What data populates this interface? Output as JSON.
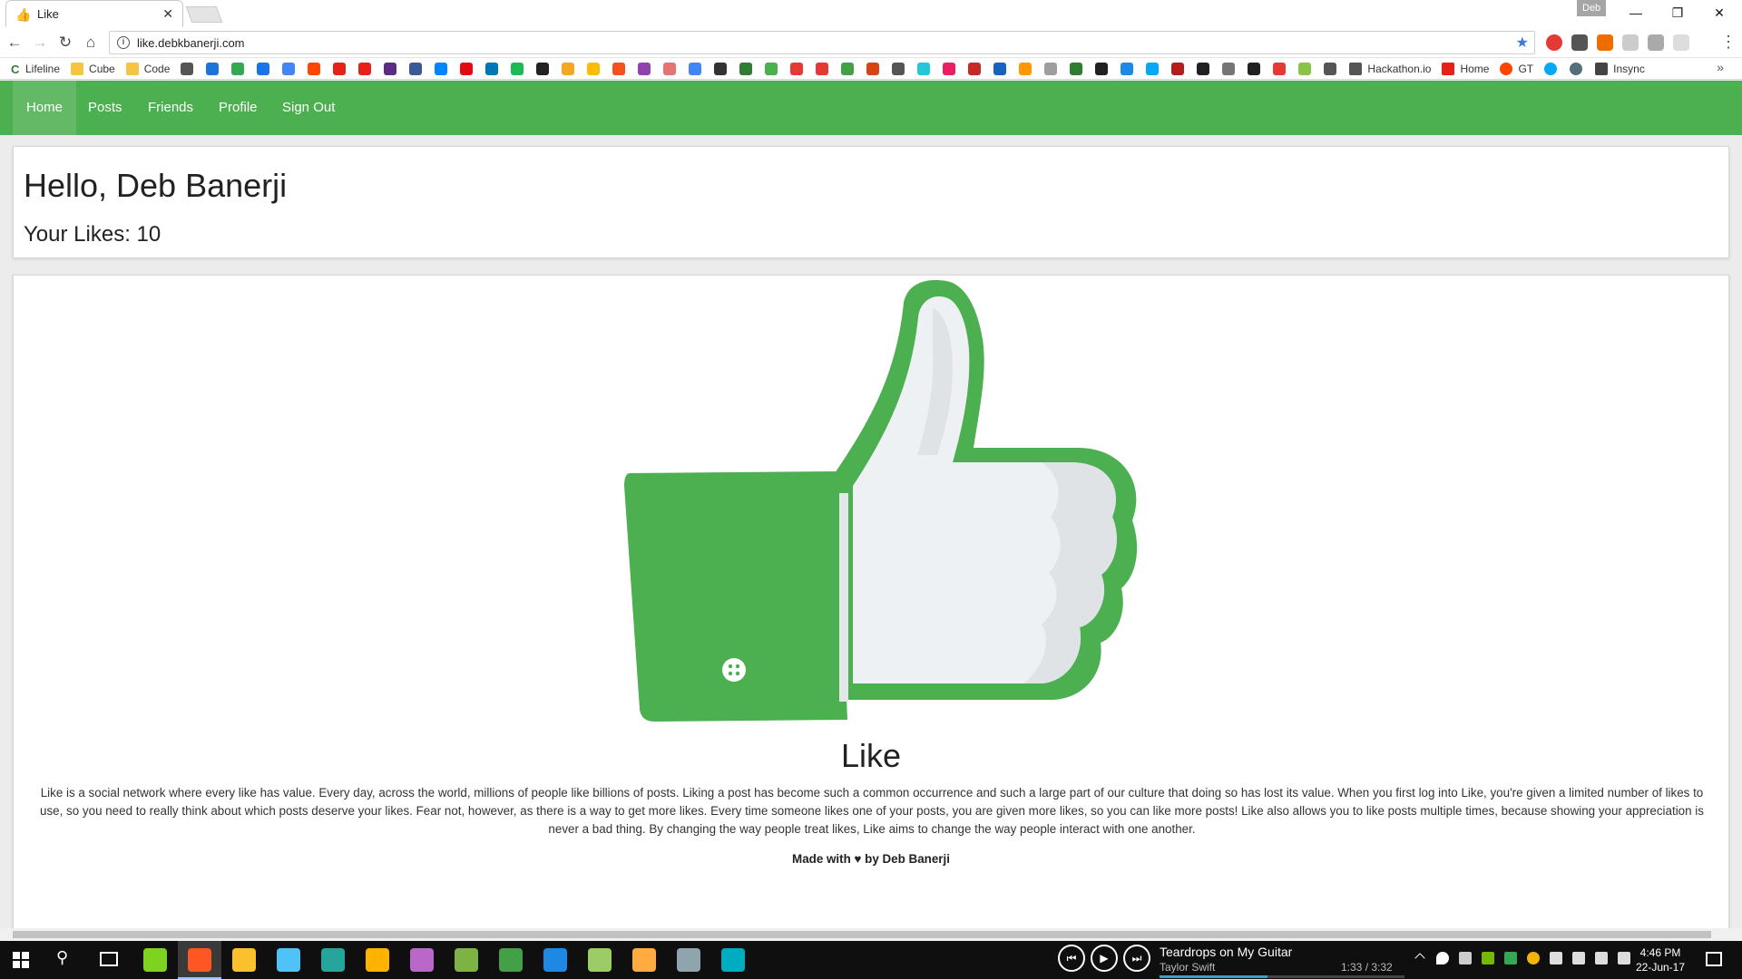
{
  "browser": {
    "tab_title": "Like",
    "profile_name": "Deb",
    "url": "like.debkbanerji.com",
    "bookmarks": [
      {
        "label": "Lifeline",
        "icon": "lifeline-icon"
      },
      {
        "label": "Cube",
        "icon": "folder-icon"
      },
      {
        "label": "Code",
        "icon": "folder-icon"
      }
    ],
    "bookmarks_right": [
      {
        "label": "Hackathon.io",
        "icon": "hackathon-icon"
      },
      {
        "label": "Home",
        "icon": "youtube-icon"
      },
      {
        "label": "GT",
        "icon": "reddit-icon"
      },
      {
        "label": "Insync",
        "icon": "insync-icon"
      }
    ],
    "bookmark_icon_colors": [
      "#555",
      "#1e73d8",
      "#34a853",
      "#1a73e8",
      "#4285f4",
      "#ff4500",
      "#e62117",
      "#e62117",
      "#5a2d82",
      "#3b5998",
      "#0084ff",
      "#e50914",
      "#0077b5",
      "#1db954",
      "#222",
      "#f5a623",
      "#fbbc05",
      "#f4511e",
      "#8e44ad",
      "#e57373",
      "#4285f4",
      "#333",
      "#2e7d32",
      "#4caf50",
      "#e53935",
      "#e53935",
      "#43a047",
      "#d84315",
      "#555",
      "#26c6da",
      "#e91e63",
      "#c62828",
      "#1565c0",
      "#ff9800",
      "#9e9e9e",
      "#2e7d32",
      "#212121",
      "#1e88e5",
      "#03a9f4",
      "#b71c1c",
      "#212121",
      "#757575",
      "#212121",
      "#e53935",
      "#8bc34a",
      "#555"
    ]
  },
  "app": {
    "nav": {
      "home": "Home",
      "posts": "Posts",
      "friends": "Friends",
      "profile": "Profile",
      "signout": "Sign Out"
    },
    "accent_color": "#4caf50",
    "greeting": "Hello, Deb Banerji",
    "likes_line": "Your Likes: 10",
    "like_title": "Like",
    "description": "Like is a social network where every like has value. Every day, across the world, millions of people like billions of posts. Liking a post has become such a common occurrence and such a large part of our culture that doing so has lost its value. When you first log into Like, you're given a limited number of likes to use, so you need to really think about which posts deserve your likes. Fear not, however, as there is a way to get more likes. Every time someone likes one of your posts, you are given more likes, so you can like more posts! Like also allows you to like posts multiple times, because showing your appreciation is never a bad thing. By changing the way people treat likes, Like aims to change the way people interact with one another.",
    "footer": "Made with ♥ by Deb Banerji"
  },
  "taskbar": {
    "now_playing": {
      "title": "Teardrops on My Guitar",
      "artist": "Taylor Swift",
      "time": "1:33 / 3:32",
      "progress_fraction": 0.44
    },
    "clock_time": "4:46 PM",
    "clock_date": "22-Jun-17",
    "pinned_app_colors": [
      "#7ed321",
      "#ff5722",
      "#fbc02d",
      "#4fc3f7",
      "#26a69a",
      "#ffb300",
      "#ba68c8",
      "#7cb342",
      "#43a047",
      "#1e88e5",
      "#9ccc65",
      "#ffab40",
      "#90a4ae",
      "#00acc1"
    ]
  }
}
